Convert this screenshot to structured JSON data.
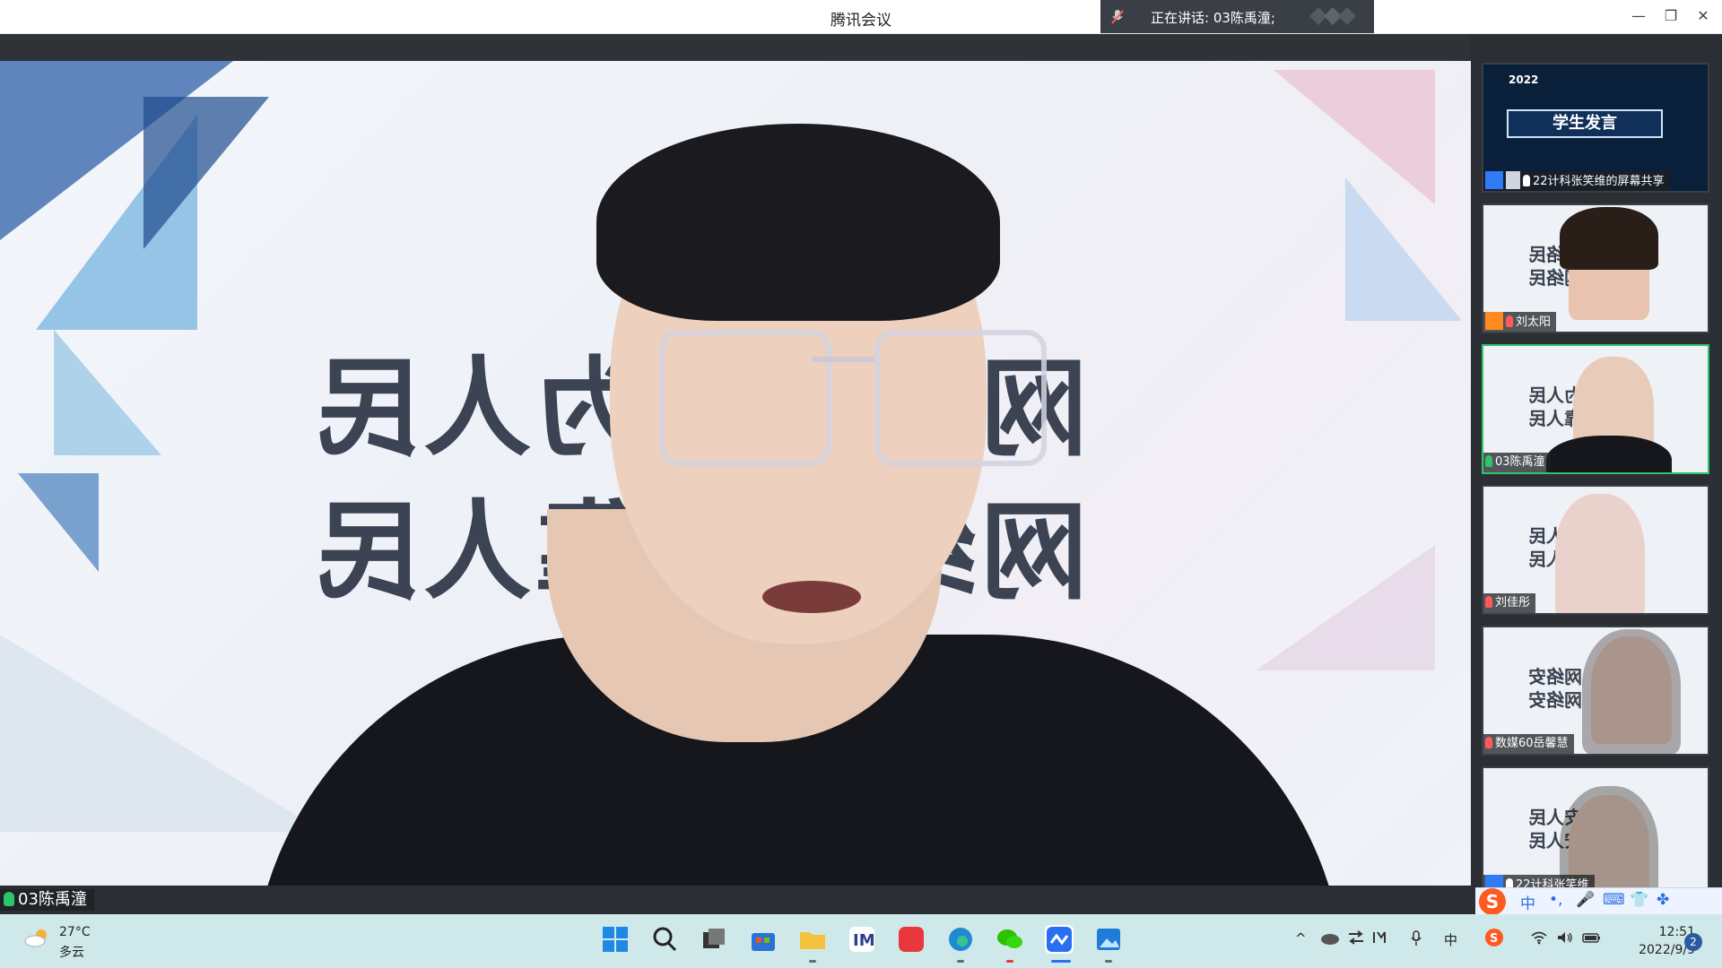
{
  "window": {
    "title": "腾讯会议"
  },
  "speaking_bar": {
    "text": "正在讲话: 03陈禹潼;"
  },
  "window_controls": {
    "minimize": "—",
    "restore": "❐",
    "close": "✕"
  },
  "main_video": {
    "name_tag": "03陈禹潼"
  },
  "participants": [
    {
      "label": "22计科张笑维的屏幕共享",
      "year": "2022",
      "banner": "学生发言",
      "type": "share"
    },
    {
      "label": "刘太阳",
      "type": "camera"
    },
    {
      "label": "03陈禹潼",
      "type": "camera",
      "active": true
    },
    {
      "label": "刘佳彤",
      "type": "camera"
    },
    {
      "label": "数媒60岳馨慧",
      "type": "camera"
    },
    {
      "label": "22计科张笑维",
      "type": "camera"
    }
  ],
  "ime": {
    "logo": "S",
    "mode": "中",
    "punct": "•,",
    "mic": "🎤",
    "keyboard": "⌨",
    "skin": "👕",
    "more": "✤"
  },
  "taskbar": {
    "weather": {
      "temp": "27°C",
      "condition": "多云"
    },
    "tray": {
      "chevron": "^",
      "input_lang": "中"
    },
    "clock": {
      "time": "12:51",
      "date": "2022/9/9"
    },
    "notification_count": "2"
  }
}
